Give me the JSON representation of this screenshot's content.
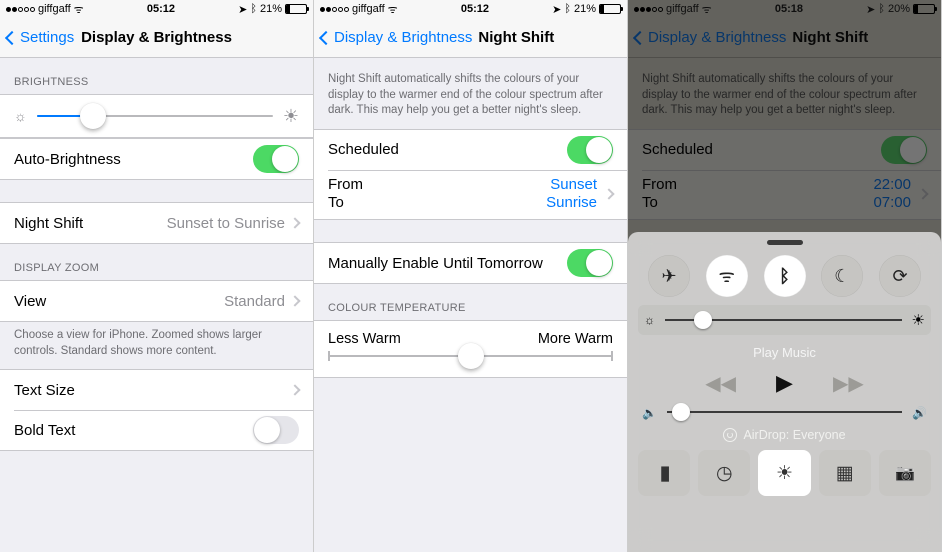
{
  "pane1": {
    "status": {
      "carrier": "giffgaff",
      "time": "05:12",
      "battery_pct": "21%",
      "signal_filled": 2,
      "wifi": true,
      "location": true,
      "bluetooth": true,
      "battery_level": 21
    },
    "nav": {
      "back": "Settings",
      "title": "Display & Brightness"
    },
    "brightness_header": "BRIGHTNESS",
    "brightness_pct": 24,
    "auto_brightness": {
      "label": "Auto-Brightness",
      "on": true
    },
    "night_shift": {
      "label": "Night Shift",
      "detail": "Sunset to Sunrise"
    },
    "zoom_header": "DISPLAY ZOOM",
    "view": {
      "label": "View",
      "detail": "Standard"
    },
    "zoom_footer": "Choose a view for iPhone. Zoomed shows larger controls. Standard shows more content.",
    "text_size": {
      "label": "Text Size"
    },
    "bold_text": {
      "label": "Bold Text",
      "on": false
    }
  },
  "pane2": {
    "status": {
      "carrier": "giffgaff",
      "time": "05:12",
      "battery_pct": "21%",
      "signal_filled": 2,
      "wifi": true,
      "location": true,
      "bluetooth": true,
      "battery_level": 21
    },
    "nav": {
      "back": "Display & Brightness",
      "title": "Night Shift"
    },
    "intro": "Night Shift automatically shifts the colours of your display to the warmer end of the colour spectrum after dark. This may help you get a better night's sleep.",
    "scheduled": {
      "label": "Scheduled",
      "on": true
    },
    "from_label": "From",
    "to_label": "To",
    "from_value": "Sunset",
    "to_value": "Sunrise",
    "manual": {
      "label": "Manually Enable Until Tomorrow",
      "on": true
    },
    "temp_header": "COLOUR TEMPERATURE",
    "temp_less": "Less Warm",
    "temp_more": "More Warm",
    "temp_pct": 50
  },
  "pane3": {
    "status": {
      "carrier": "giffgaff",
      "time": "05:18",
      "battery_pct": "20%",
      "signal_filled": 3,
      "wifi": true,
      "location": true,
      "bluetooth": true,
      "battery_level": 20
    },
    "nav": {
      "back": "Display & Brightness",
      "title": "Night Shift"
    },
    "intro": "Night Shift automatically shifts the colours of your display to the warmer end of the colour spectrum after dark. This may help you get a better night's sleep.",
    "scheduled": {
      "label": "Scheduled",
      "on": true
    },
    "from_label": "From",
    "to_label": "To",
    "from_value": "22:00",
    "to_value": "07:00",
    "cc": {
      "brightness_pct": 16,
      "volume_pct": 6,
      "play_music": "Play Music",
      "airdrop": "AirDrop: Everyone",
      "toggles": {
        "airplane": false,
        "wifi": true,
        "bluetooth": true,
        "dnd": false,
        "orientation_lock": false
      },
      "night_shift_on": true
    }
  }
}
